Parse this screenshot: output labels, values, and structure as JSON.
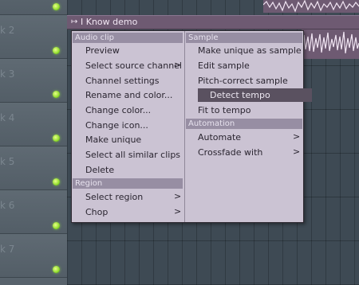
{
  "tracks": [
    {
      "label": "k 2"
    },
    {
      "label": "k 3"
    },
    {
      "label": "k 4"
    },
    {
      "label": "k 5"
    },
    {
      "label": "k 6"
    },
    {
      "label": "k 7"
    }
  ],
  "clip": {
    "icon": "clip-arrow-icon",
    "title": "I Know demo"
  },
  "menu": {
    "audio_clip_header": "Audio clip",
    "audio_clip_items": [
      {
        "label": "Preview"
      },
      {
        "label": "Select source channel",
        "submenu": true
      },
      {
        "label": "Channel settings"
      },
      {
        "label": "Rename and color..."
      },
      {
        "label": "Change color..."
      },
      {
        "label": "Change icon..."
      },
      {
        "label": "Make unique"
      },
      {
        "label": "Select all similar clips"
      },
      {
        "label": "Delete"
      }
    ],
    "region_header": "Region",
    "region_items": [
      {
        "label": "Select region",
        "submenu": true
      },
      {
        "label": "Chop",
        "submenu": true
      }
    ],
    "sample_header": "Sample",
    "sample_items": [
      {
        "label": "Make unique as sample"
      },
      {
        "label": "Edit sample"
      },
      {
        "label": "Pitch-correct sample"
      },
      {
        "label": "Detect tempo",
        "highlighted": true
      },
      {
        "label": "Fit to tempo"
      }
    ],
    "automation_header": "Automation",
    "automation_items": [
      {
        "label": "Automate",
        "submenu": true
      },
      {
        "label": "Crossfade with",
        "submenu": true
      }
    ],
    "submenu_glyph": ">"
  },
  "colors": {
    "menu_bg": "#cbc3d3",
    "section_bg": "#978ea3",
    "highlight_bg": "#5a5160",
    "clip_bar": "#6e5a72",
    "led": "#8fdc2b"
  }
}
